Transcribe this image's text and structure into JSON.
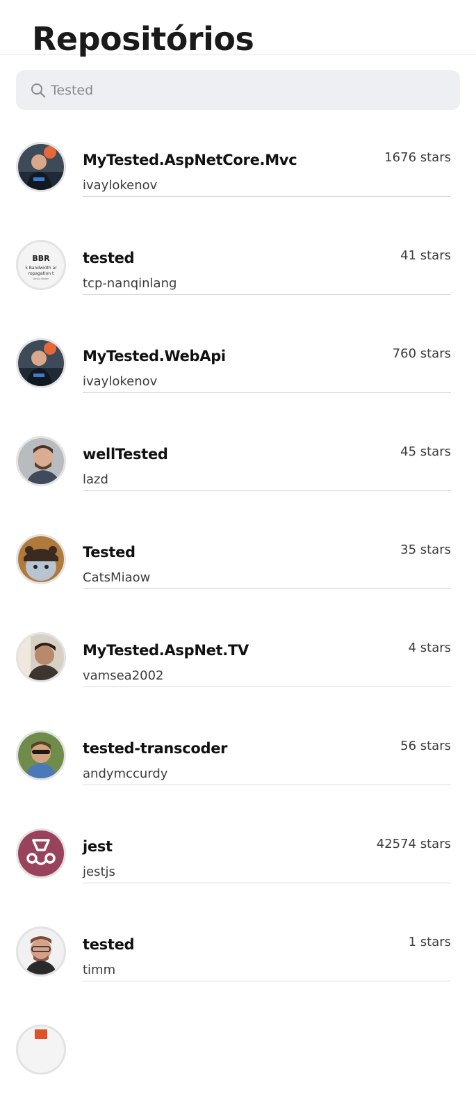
{
  "header": {
    "title": "Repositórios"
  },
  "search": {
    "value": "Tested",
    "icon": "search-icon"
  },
  "repos": [
    {
      "name": "MyTested.AspNetCore.Mvc",
      "owner": "ivaylokenov",
      "stars": "1676 stars",
      "avatar": "photo-man-orange-balloon"
    },
    {
      "name": "tested",
      "owner": "tcp-nanqinlang",
      "stars": "41 stars",
      "avatar": "bbr-text-logo"
    },
    {
      "name": "MyTested.WebApi",
      "owner": "ivaylokenov",
      "stars": "760 stars",
      "avatar": "photo-man-orange-balloon"
    },
    {
      "name": "wellTested",
      "owner": "lazd",
      "stars": "45 stars",
      "avatar": "photo-man-beard"
    },
    {
      "name": "Tested",
      "owner": "CatsMiaow",
      "stars": "35 stars",
      "avatar": "photo-cat-hat"
    },
    {
      "name": "MyTested.AspNet.TV",
      "owner": "vamsea2002",
      "stars": "4 stars",
      "avatar": "photo-man-dark"
    },
    {
      "name": "tested-transcoder",
      "owner": "andymccurdy",
      "stars": "56 stars",
      "avatar": "photo-man-sunglasses"
    },
    {
      "name": "jest",
      "owner": "jestjs",
      "stars": "42574 stars",
      "avatar": "jest-logo"
    },
    {
      "name": "tested",
      "owner": "timm",
      "stars": "1 stars",
      "avatar": "photo-man-glasses"
    }
  ],
  "colors": {
    "search_bg": "#eeeff2",
    "divider": "#d9d9d9",
    "jest_brand": "#99425b"
  }
}
